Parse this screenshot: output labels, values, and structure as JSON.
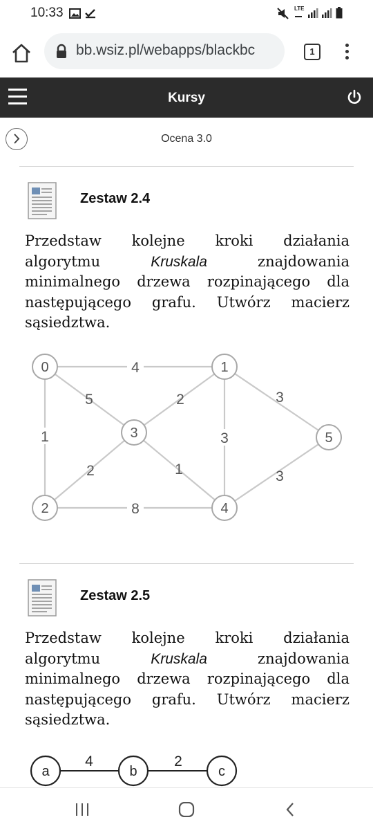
{
  "status_bar": {
    "time": "10:33",
    "network_label": "LTE",
    "icons": [
      "image-icon",
      "check-icon",
      "mute-icon",
      "signal-icon",
      "signal-icon",
      "battery-icon"
    ]
  },
  "browser": {
    "url": "bb.wsiz.pl/webapps/blackbc",
    "tab_count": "1"
  },
  "app_bar": {
    "title": "Kursy"
  },
  "sub_header": {
    "label": "Ocena 3.0"
  },
  "items": [
    {
      "title": "Zestaw 2.4",
      "text_before": "Przedstaw kolejne kroki działania algorytmu ",
      "text_italic": "Kruskala",
      "text_after": " znajdowania minimalnego drzewa rozpinającego dla następującego grafu. Utwórz macierz sąsiedztwa.",
      "graph": {
        "nodes": [
          "0",
          "1",
          "2",
          "3",
          "4",
          "5"
        ],
        "edge_weights": {
          "e01": "4",
          "e03": "5",
          "e02": "1",
          "e13": "2",
          "e14": "3",
          "e15": "3",
          "e23": "2",
          "e34": "1",
          "e24": "8",
          "e45": "3"
        }
      }
    },
    {
      "title": "Zestaw 2.5",
      "text_before": "Przedstaw kolejne kroki działania algorytmu ",
      "text_italic": "Kruskala",
      "text_after": " znajdowania minimalnego drzewa rozpinającego dla następującego grafu. Utwórz macierz sąsiedztwa.",
      "graph": {
        "nodes": [
          "a",
          "b",
          "c"
        ],
        "edge_weights": {
          "eab": "4",
          "ebc": "2"
        }
      }
    }
  ],
  "colors": {
    "app_bar_bg": "#2b2b2b",
    "omnibox_bg": "#f1f3f4",
    "graph_edge": "#c9c9c9",
    "graph_node_border": "#a8a8a8"
  }
}
